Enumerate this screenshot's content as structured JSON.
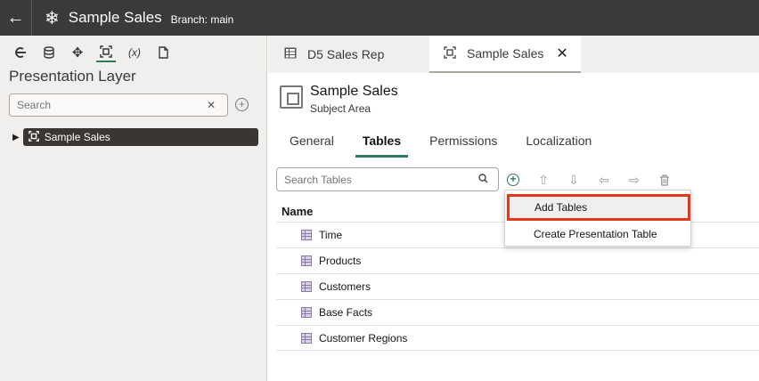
{
  "topbar": {
    "back_icon": "←",
    "app_icon": "❄",
    "title": "Sample Sales",
    "branch": "Branch: main"
  },
  "left": {
    "toolbar": [
      "C",
      "DB",
      "✥",
      "▣",
      "(x)",
      "doc"
    ],
    "title": "Presentation Layer",
    "search_placeholder": "Search",
    "clear_icon": "✕",
    "add_icon": "+",
    "tree_caret": "▶",
    "tree_node_icon": "⌗",
    "tree_node": "Sample Sales"
  },
  "tabs": {
    "tab1": {
      "icon": "▦",
      "label": "D5 Sales Rep"
    },
    "tab2": {
      "icon": "▣",
      "label": "Sample Sales",
      "close": "✕"
    }
  },
  "subject": {
    "title": "Sample Sales",
    "subtitle": "Subject Area"
  },
  "content_tabs": [
    "General",
    "Tables",
    "Permissions",
    "Localization"
  ],
  "table_search_placeholder": "Search Tables",
  "toolbar": {
    "add": "+",
    "up": "⇧",
    "down": "⇩",
    "left": "⇦",
    "right": "⇨",
    "delete": "🗑"
  },
  "column_header": "Name",
  "tables": [
    "Time",
    "Products",
    "Customers",
    "Base Facts",
    "Customer Regions"
  ],
  "dropdown": {
    "item1": "Add Tables",
    "item2": "Create Presentation Table"
  },
  "colors": {
    "accent": "#2f7a5a",
    "highlight_border": "#e6361d",
    "topbar": "#3a3a3a"
  }
}
